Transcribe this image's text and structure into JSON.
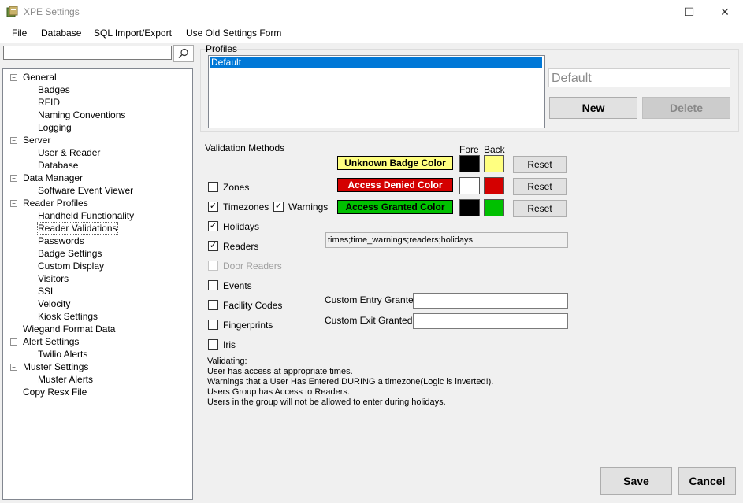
{
  "window": {
    "title": "XPE Settings",
    "minimize": "—",
    "maximize": "☐",
    "close": "✕"
  },
  "menu": [
    "File",
    "Database",
    "SQL Import/Export",
    "Use Old Settings Form"
  ],
  "tree": {
    "general": "General",
    "badges": "Badges",
    "rfid": "RFID",
    "naming": "Naming Conventions",
    "logging": "Logging",
    "server": "Server",
    "user_reader": "User & Reader",
    "database": "Database",
    "data_manager": "Data Manager",
    "software_event_viewer": "Software Event Viewer",
    "reader_profiles": "Reader Profiles",
    "handheld": "Handheld Functionality",
    "reader_validations": "Reader Validations",
    "passwords": "Passwords",
    "badge_settings": "Badge Settings",
    "custom_display": "Custom Display",
    "visitors": "Visitors",
    "ssl": "SSL",
    "velocity": "Velocity",
    "kiosk": "Kiosk Settings",
    "wiegand": "Wiegand Format Data",
    "alert_settings": "Alert Settings",
    "twilio": "Twilio Alerts",
    "muster_settings": "Muster Settings",
    "muster_alerts": "Muster Alerts",
    "copy_resx": "Copy Resx File"
  },
  "profiles": {
    "label": "Profiles",
    "items": [
      "Default"
    ],
    "name_value": "Default",
    "new_label": "New",
    "delete_label": "Delete"
  },
  "validation": {
    "label": "Validation Methods",
    "fore": "Fore",
    "back": "Back",
    "unknown_badge": "Unknown Badge Color",
    "access_denied": "Access Denied Color",
    "access_granted": "Access Granted Color",
    "reset": "Reset",
    "zones": "Zones",
    "timezones": "Timezones",
    "warnings": "Warnings",
    "holidays": "Holidays",
    "readers": "Readers",
    "door_readers": "Door Readers",
    "events": "Events",
    "facility_codes": "Facility Codes",
    "fingerprints": "Fingerprints",
    "iris": "Iris",
    "checked_mark": "✓",
    "summary": "times;time_warnings;readers;holidays",
    "custom_entry_label": "Custom Entry Granted:",
    "custom_exit_label": "Custom Exit Granted:",
    "custom_entry_value": "",
    "custom_exit_value": "",
    "validating_lines": [
      "Validating:",
      "User has access at appropriate times.",
      "Warnings that a User Has Entered DURING a timezone(Logic is inverted!).",
      "Users Group has Access to Readers.",
      "Users in the group will not be allowed to enter during holidays."
    ]
  },
  "colors": {
    "unknown_bg": "#ffff80",
    "denied_bg": "#d40000",
    "granted_bg": "#00c000",
    "unknown_fore": "#000000",
    "unknown_back": "#ffff80",
    "denied_fore": "#ffffff",
    "denied_back": "#d40000",
    "granted_fore": "#000000",
    "granted_back": "#00c000",
    "selection": "#0078d7"
  },
  "footer": {
    "save": "Save",
    "cancel": "Cancel"
  }
}
